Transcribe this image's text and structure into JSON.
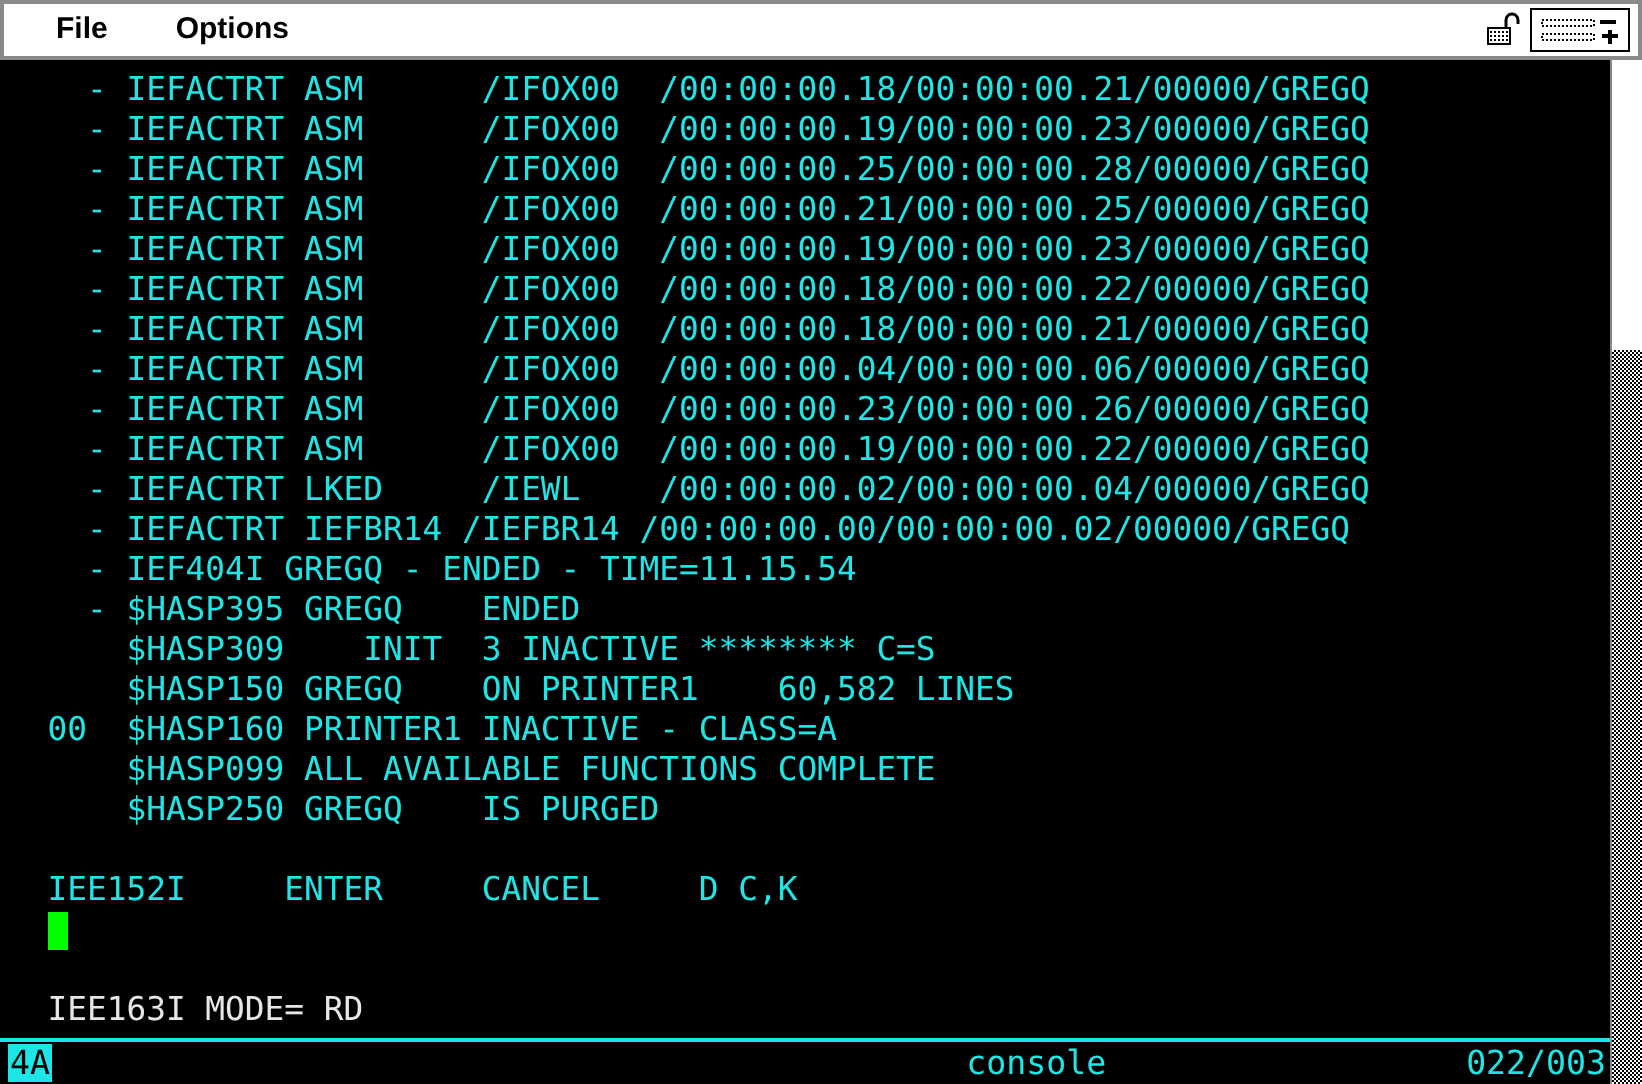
{
  "menu": [
    {
      "label": "File"
    },
    {
      "label": "Options"
    }
  ],
  "console": {
    "lines": [
      {
        "kind": "text",
        "color": "#1ee6e6",
        "text": "    - IEFACTRT ASM      /IFOX00  /00:00:00.18/00:00:00.21/00000/GREGQ"
      },
      {
        "kind": "text",
        "color": "#1ee6e6",
        "text": "    - IEFACTRT ASM      /IFOX00  /00:00:00.19/00:00:00.23/00000/GREGQ"
      },
      {
        "kind": "text",
        "color": "#1ee6e6",
        "text": "    - IEFACTRT ASM      /IFOX00  /00:00:00.25/00:00:00.28/00000/GREGQ"
      },
      {
        "kind": "text",
        "color": "#1ee6e6",
        "text": "    - IEFACTRT ASM      /IFOX00  /00:00:00.21/00:00:00.25/00000/GREGQ"
      },
      {
        "kind": "text",
        "color": "#1ee6e6",
        "text": "    - IEFACTRT ASM      /IFOX00  /00:00:00.19/00:00:00.23/00000/GREGQ"
      },
      {
        "kind": "text",
        "color": "#1ee6e6",
        "text": "    - IEFACTRT ASM      /IFOX00  /00:00:00.18/00:00:00.22/00000/GREGQ"
      },
      {
        "kind": "text",
        "color": "#1ee6e6",
        "text": "    - IEFACTRT ASM      /IFOX00  /00:00:00.18/00:00:00.21/00000/GREGQ"
      },
      {
        "kind": "text",
        "color": "#1ee6e6",
        "text": "    - IEFACTRT ASM      /IFOX00  /00:00:00.04/00:00:00.06/00000/GREGQ"
      },
      {
        "kind": "text",
        "color": "#1ee6e6",
        "text": "    - IEFACTRT ASM      /IFOX00  /00:00:00.23/00:00:00.26/00000/GREGQ"
      },
      {
        "kind": "text",
        "color": "#1ee6e6",
        "text": "    - IEFACTRT ASM      /IFOX00  /00:00:00.19/00:00:00.22/00000/GREGQ"
      },
      {
        "kind": "text",
        "color": "#1ee6e6",
        "text": "    - IEFACTRT LKED     /IEWL    /00:00:00.02/00:00:00.04/00000/GREGQ"
      },
      {
        "kind": "text",
        "color": "#1ee6e6",
        "text": "    - IEFACTRT IEFBR14 /IEFBR14 /00:00:00.00/00:00:00.02/00000/GREGQ"
      },
      {
        "kind": "text",
        "color": "#1ee6e6",
        "text": "    - IEF404I GREGQ - ENDED - TIME=11.15.54"
      },
      {
        "kind": "text",
        "color": "#1ee6e6",
        "text": "    - $HASP395 GREGQ    ENDED"
      },
      {
        "kind": "text",
        "color": "#1ee6e6",
        "text": "      $HASP309    INIT  3 INACTIVE ******** C=S"
      },
      {
        "kind": "text",
        "color": "#1ee6e6",
        "text": "      $HASP150 GREGQ    ON PRINTER1    60,582 LINES"
      },
      {
        "kind": "text",
        "color": "#1ee6e6",
        "text": "  00  $HASP160 PRINTER1 INACTIVE - CLASS=A"
      },
      {
        "kind": "text",
        "color": "#1ee6e6",
        "text": "      $HASP099 ALL AVAILABLE FUNCTIONS COMPLETE"
      },
      {
        "kind": "text",
        "color": "#1ee6e6",
        "text": "      $HASP250 GREGQ    IS PURGED"
      },
      {
        "kind": "blank"
      },
      {
        "kind": "text",
        "color": "#1ee6e6",
        "text": "  IEE152I     ENTER     CANCEL     D C,K"
      },
      {
        "kind": "cursor"
      },
      {
        "kind": "blank"
      },
      {
        "kind": "text",
        "color": "#e6e6e6",
        "text": "  IEE163I MODE= RD"
      }
    ]
  },
  "status_bar": {
    "session": "4A",
    "mode": "console",
    "position": "022/003"
  }
}
